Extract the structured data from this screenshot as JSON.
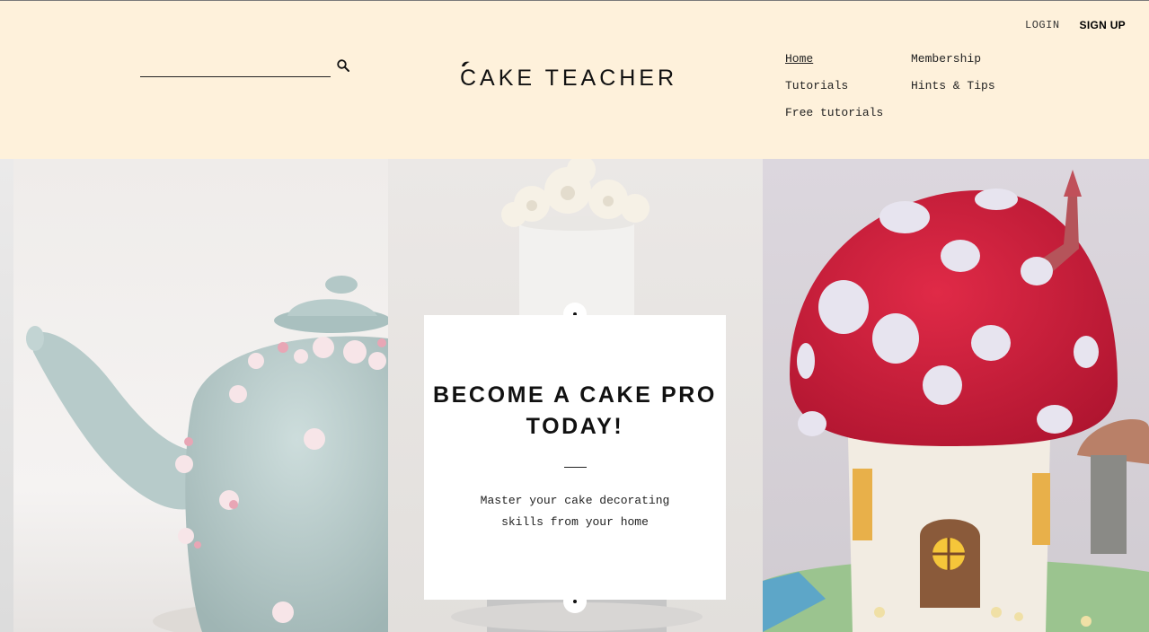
{
  "header": {
    "login_label": "LOGIN",
    "signup_label": "SIGN UP",
    "search": {
      "value": "",
      "placeholder": ""
    },
    "logo_text": "CAKE TEACHER",
    "background": "#fef1db"
  },
  "nav": {
    "items": [
      {
        "label": "Home",
        "active": true
      },
      {
        "label": "Membership",
        "active": false
      },
      {
        "label": "Tutorials",
        "active": false
      },
      {
        "label": "Hints & Tips",
        "active": false
      },
      {
        "label": "Free tutorials",
        "active": false
      }
    ]
  },
  "hero": {
    "headline": "BECOME A CAKE PRO TODAY!",
    "subtext": "Master your cake decorating skills from your home",
    "images": [
      "teapot-cake",
      "white-flower-tiered-cake",
      "toadstool-cake"
    ]
  },
  "colors": {
    "cream": "#fef1db",
    "toadstool_red": "#d01e3a",
    "teapot_blue": "#b9cdcc"
  }
}
